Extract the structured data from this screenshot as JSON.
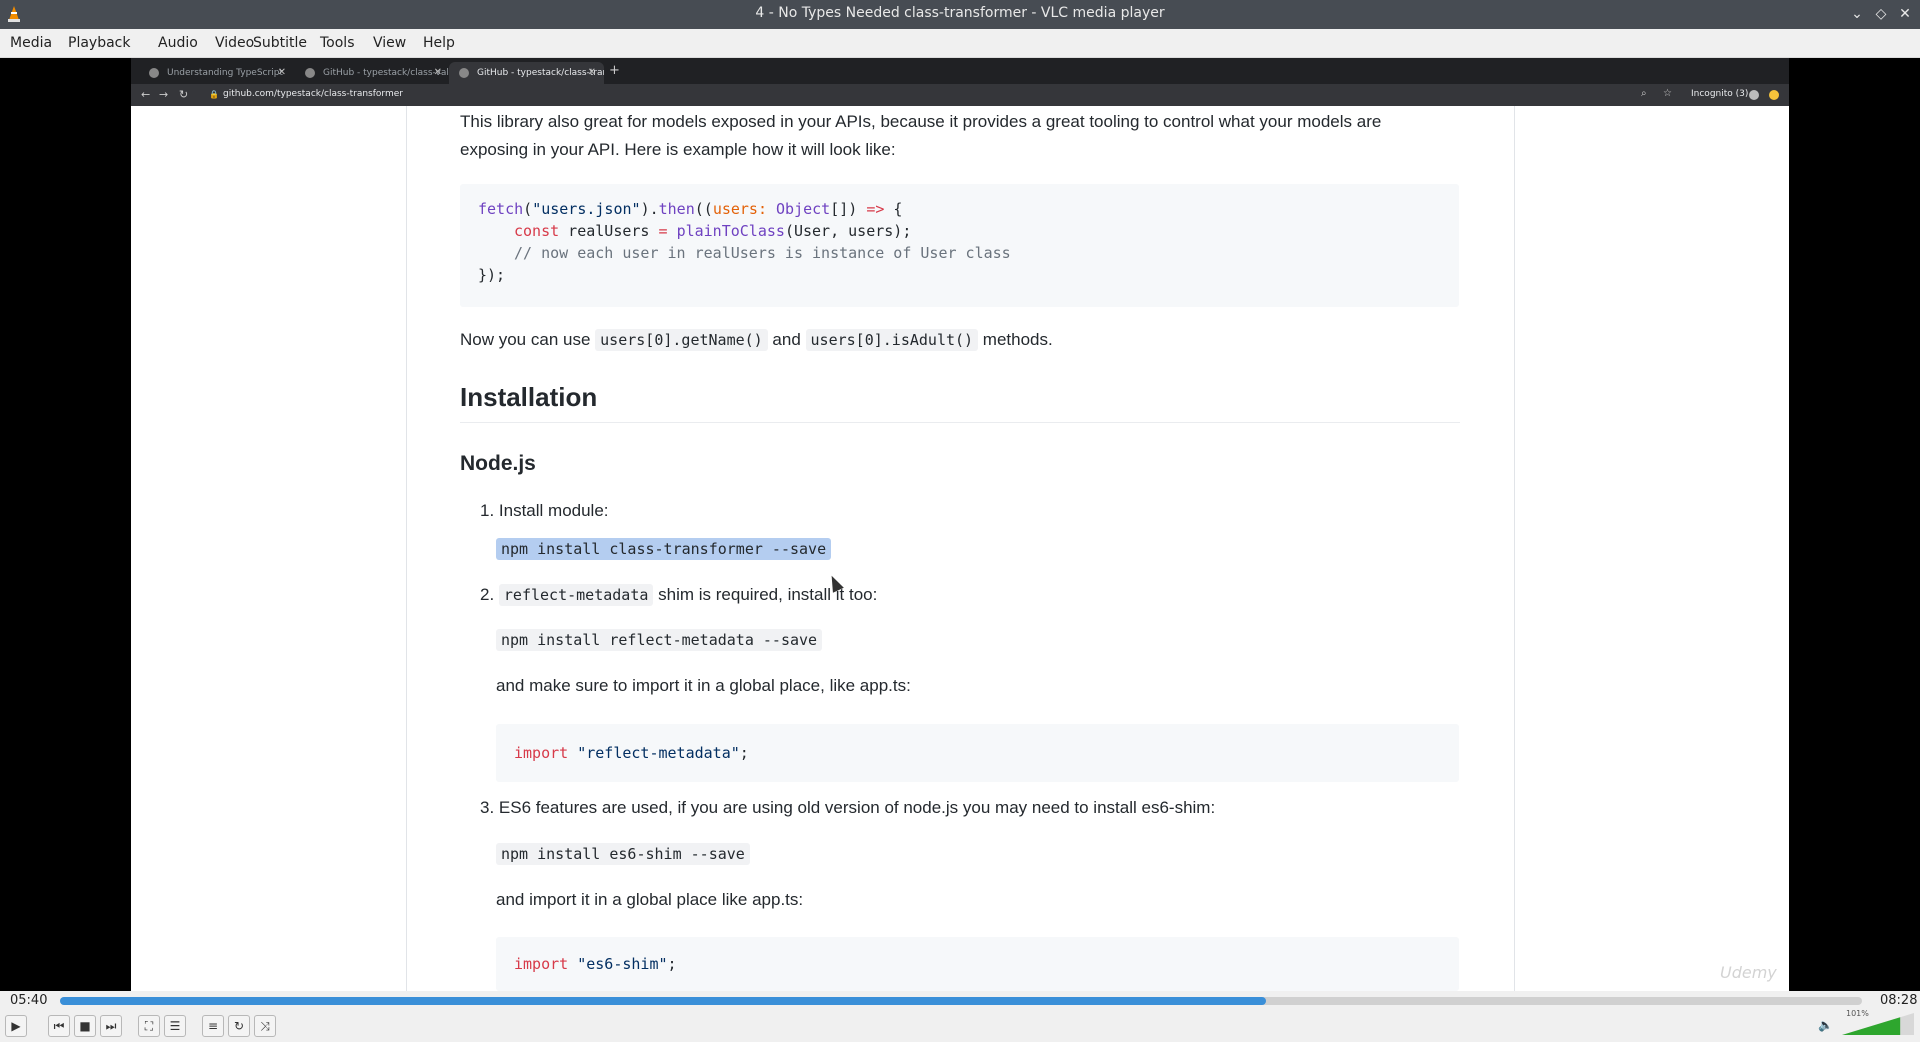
{
  "window": {
    "title": "4 - No Types Needed class-transformer - VLC media player",
    "controls": [
      "chevron-down",
      "restore",
      "close"
    ]
  },
  "menu": [
    "Media",
    "Playback",
    "Audio",
    "Video",
    "Subtitle",
    "Tools",
    "View",
    "Help"
  ],
  "browser": {
    "tabs": [
      "Understanding TypeScript",
      "GitHub - typestack/class-vali",
      "GitHub - typestack/class-tran"
    ],
    "active_tab": 2,
    "new_tab": "+",
    "url": "github.com/typestack/class-transformer",
    "incognito": "Incognito (3)"
  },
  "article": {
    "intro_line1": "This library also great for models exposed in your APIs, because it provides a great tooling to control what your models are",
    "intro_line2": "exposing in your API. Here is example how it will look like:",
    "code1": {
      "l1_fetch": "fetch",
      "l1_paren": "(",
      "l1_str": "\"users.json\"",
      "l1_dot": ").",
      "l1_then": "then",
      "l1_paren2": "((",
      "l1_users": "users",
      "l1_colon": ": ",
      "l1_type": "Object",
      "l1_rest1": "[]) ",
      "l1_arrow": "=>",
      "l1_brace": " {",
      "l2_const": "const",
      "l2_var": " realUsers ",
      "l2_eq": "=",
      "l2_sp": " ",
      "l2_fn": "plainToClass",
      "l2_args": "(User, users);",
      "l3_comment": "// now each user in realUsers is instance of User class",
      "l4": "});"
    },
    "now_prefix": "Now you can use ",
    "now_code1": "users[0].getName()",
    "now_and": " and ",
    "now_code2": "users[0].isAdult()",
    "now_suffix": " methods.",
    "h_installation": "Installation",
    "h_node": "Node.js",
    "step1_label": "1. Install module:",
    "step1_code": "npm install class-transformer --save",
    "step2_num": "2. ",
    "step2_code": "reflect-metadata",
    "step2_text": " shim is required, install it too:",
    "step2_cmd": "npm install reflect-metadata --save",
    "step2_note": "and make sure to import it in a global place, like app.ts:",
    "import1_kw": "import",
    "import1_str": "\"reflect-metadata\"",
    "import1_end": ";",
    "step3_text": "3. ES6 features are used, if you are using old version of node.js you may need to install es6-shim:",
    "step3_cmd": "npm install es6-shim --save",
    "step3_note": "and import it in a global place like app.ts:",
    "import2_kw": "import",
    "import2_str": "\"es6-shim\"",
    "import2_end": ";"
  },
  "watermark": "Udemy",
  "player": {
    "elapsed": "05:40",
    "total": "08:28",
    "progress": 0.669,
    "volume_label": "101%",
    "volume": 1.01,
    "buttons": [
      "play",
      "previous",
      "stop",
      "next",
      "fullscreen",
      "extended-settings",
      "playlist",
      "loop",
      "random"
    ]
  },
  "colors": {
    "titlebar": "#474c53",
    "seek_fill": "#3a8fd8",
    "volume": "#2ea62e",
    "selection": "#b4cdf0"
  }
}
